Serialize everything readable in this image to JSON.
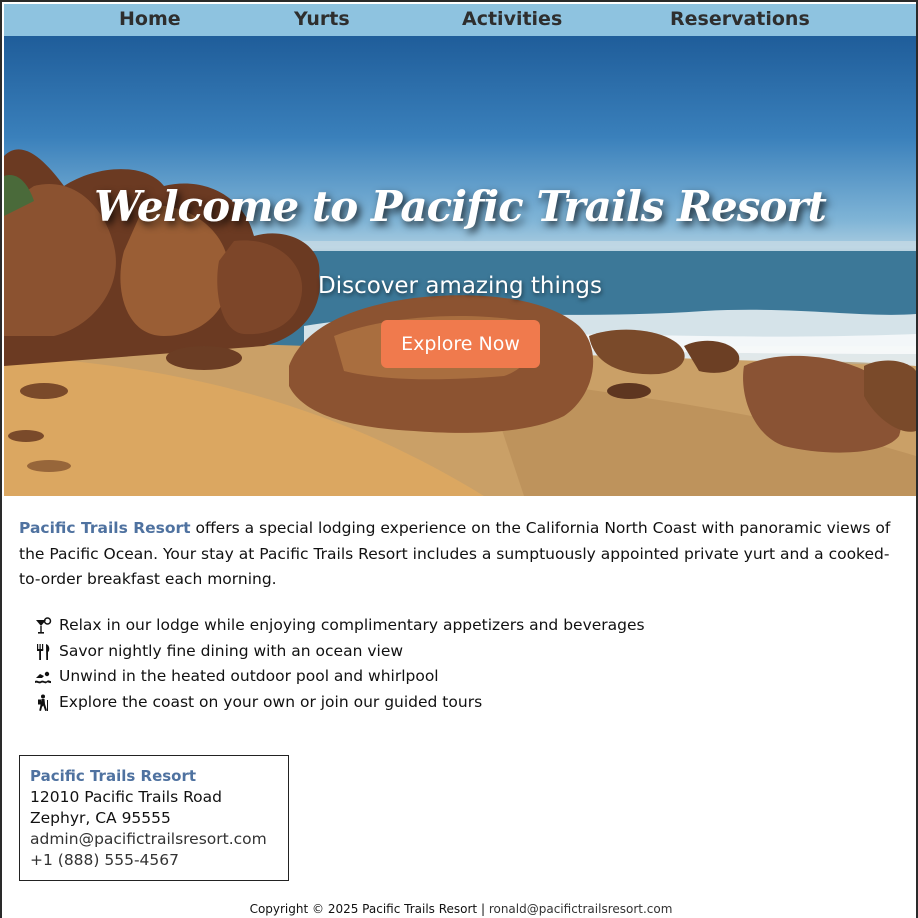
{
  "nav": {
    "items": [
      {
        "label": "Home"
      },
      {
        "label": "Yurts"
      },
      {
        "label": "Activities"
      },
      {
        "label": "Reservations"
      }
    ]
  },
  "hero": {
    "title": "Welcome to Pacific Trails Resort",
    "subtitle": "Discover amazing things",
    "cta_label": "Explore Now"
  },
  "intro": {
    "brand": "Pacific Trails Resort",
    "text": " offers a special lodging experience on the California North Coast with panoramic views of the Pacific Ocean. Your stay at Pacific Trails Resort includes a sumptuously appointed private yurt and a cooked-to-order breakfast each morning."
  },
  "features": [
    {
      "icon": "cocktail-icon",
      "text": "Relax in our lodge while enjoying complimentary appetizers and beverages"
    },
    {
      "icon": "utensils-icon",
      "text": "Savor nightly fine dining with an ocean view"
    },
    {
      "icon": "swimmer-icon",
      "text": "Unwind in the heated outdoor pool and whirlpool"
    },
    {
      "icon": "hiker-icon",
      "text": "Explore the coast on your own or join our guided tours"
    }
  ],
  "contact": {
    "name": "Pacific Trails Resort",
    "street": "12010 Pacific Trails Road",
    "city": "Zephyr, CA 95555",
    "email": "admin@pacifictrailsresort.com",
    "phone": "+1 (888) 555-4567"
  },
  "footer": {
    "copyright": "Copyright © 2025 Pacific Trails Resort | ",
    "email": "ronald@pacifictrailsresort.com"
  },
  "colors": {
    "nav_bg": "#8ec3e0",
    "accent_button": "#f07a4d",
    "brand_text": "#4f72a0"
  }
}
